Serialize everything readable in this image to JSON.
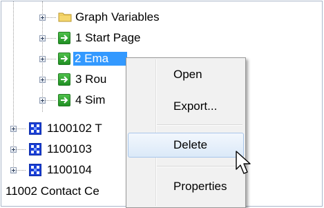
{
  "tree": {
    "items": [
      {
        "label": "Graph Variables",
        "icon": "folder-icon"
      },
      {
        "label": "1 Start Page",
        "icon": "green-arrow-icon"
      },
      {
        "label": "2 Ema",
        "icon": "green-arrow-icon",
        "selected": true
      },
      {
        "label": "3 Rou",
        "icon": "green-arrow-icon"
      },
      {
        "label": "4 Sim",
        "icon": "green-arrow-icon"
      },
      {
        "label": "1100102 T",
        "icon": "blue-grid-icon"
      },
      {
        "label": "1100103",
        "icon": "blue-grid-icon"
      },
      {
        "label": "1100104",
        "icon": "blue-grid-icon"
      },
      {
        "label": "11002 Contact Ce",
        "icon": ""
      }
    ]
  },
  "context_menu": {
    "items": [
      "Open",
      "Export...",
      "Delete",
      "Properties"
    ],
    "hovered": "Delete"
  },
  "colors": {
    "selection": "#3399ff",
    "menu_background": "#f1f1f1",
    "hover_border": "#a8c6ea"
  }
}
